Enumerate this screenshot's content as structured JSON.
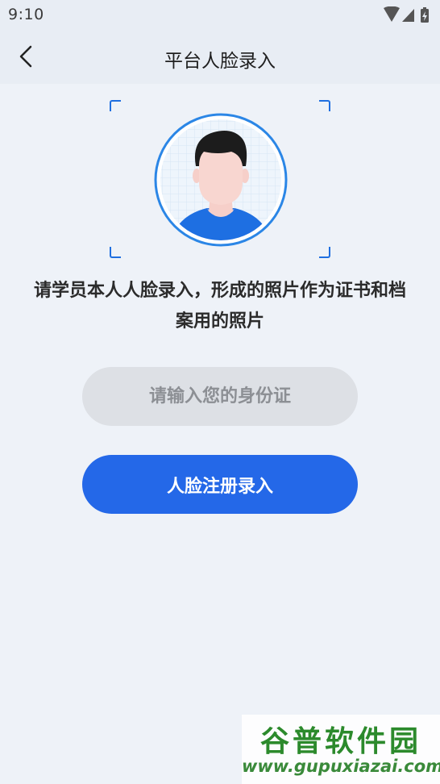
{
  "status_bar": {
    "time": "9:10",
    "icons": [
      "wifi-icon",
      "signal-icon",
      "battery-icon"
    ]
  },
  "nav": {
    "title": "平台人脸录入",
    "back_icon": "chevron-left-icon"
  },
  "instruction": "请学员本人人脸录入，形成的照片作为证书和档案用的照片",
  "id_input": {
    "placeholder": "请输入您的身份证",
    "value": ""
  },
  "register_button": {
    "label": "人脸注册录入"
  },
  "watermark": {
    "title": "谷普软件园",
    "url": "www.gupuxiazai.com"
  },
  "colors": {
    "accent": "#2468e8",
    "background": "#eef2f8",
    "input_bg": "#dde0e5",
    "frame": "#1f6fe0"
  }
}
